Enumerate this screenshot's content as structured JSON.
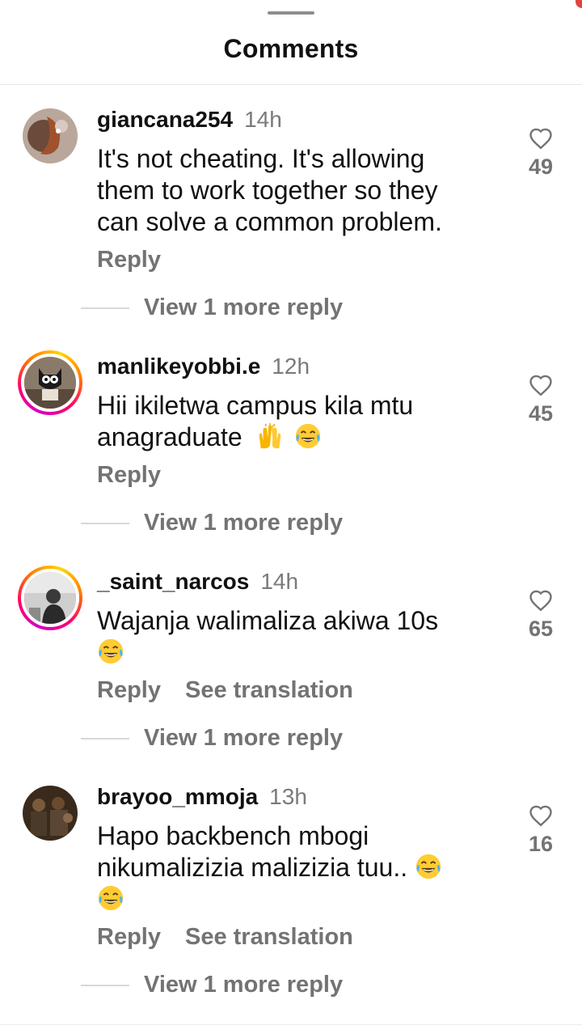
{
  "header": {
    "title": "Comments"
  },
  "comments": [
    {
      "username": "giancana254",
      "time": "14h",
      "text_lines": [
        "It's not cheating.  It's allowing",
        "them to work together so they",
        "can solve a common problem."
      ],
      "reply_label": "Reply",
      "view_replies": "View 1 more reply",
      "likes": "49"
    },
    {
      "username": "manlikeyobbi.e",
      "time": "12h",
      "text_lines": [
        "Hii ikiletwa campus kila mtu",
        "anagraduate"
      ],
      "emojis": [
        "raising-hands",
        "tears-of-joy"
      ],
      "reply_label": "Reply",
      "view_replies": "View 1 more reply",
      "likes": "45"
    },
    {
      "username": "_saint_narcos",
      "time": "14h",
      "text_lines": [
        "Wajanja walimaliza akiwa 10s"
      ],
      "emojis": [
        "tears-of-joy"
      ],
      "reply_label": "Reply",
      "translation_label": "See translation",
      "view_replies": "View 1 more reply",
      "likes": "65"
    },
    {
      "username": "brayoo_mmoja",
      "time": "13h",
      "text_lines": [
        "Hapo backbench mbogi",
        "nikumalizizia malizizia tuu.."
      ],
      "emojis": [
        "tears-of-joy",
        "tears-of-joy"
      ],
      "reply_label": "Reply",
      "translation_label": "See translation",
      "view_replies": "View 1 more reply",
      "likes": "16"
    }
  ],
  "icons": {
    "like": "heart-outline-icon",
    "grabber": "drag-handle-icon"
  },
  "colors": {
    "text": "#111111",
    "secondary": "#737373",
    "story_ring": [
      "#d300c5",
      "#ff0069",
      "#ff7a00",
      "#ffd600"
    ]
  }
}
